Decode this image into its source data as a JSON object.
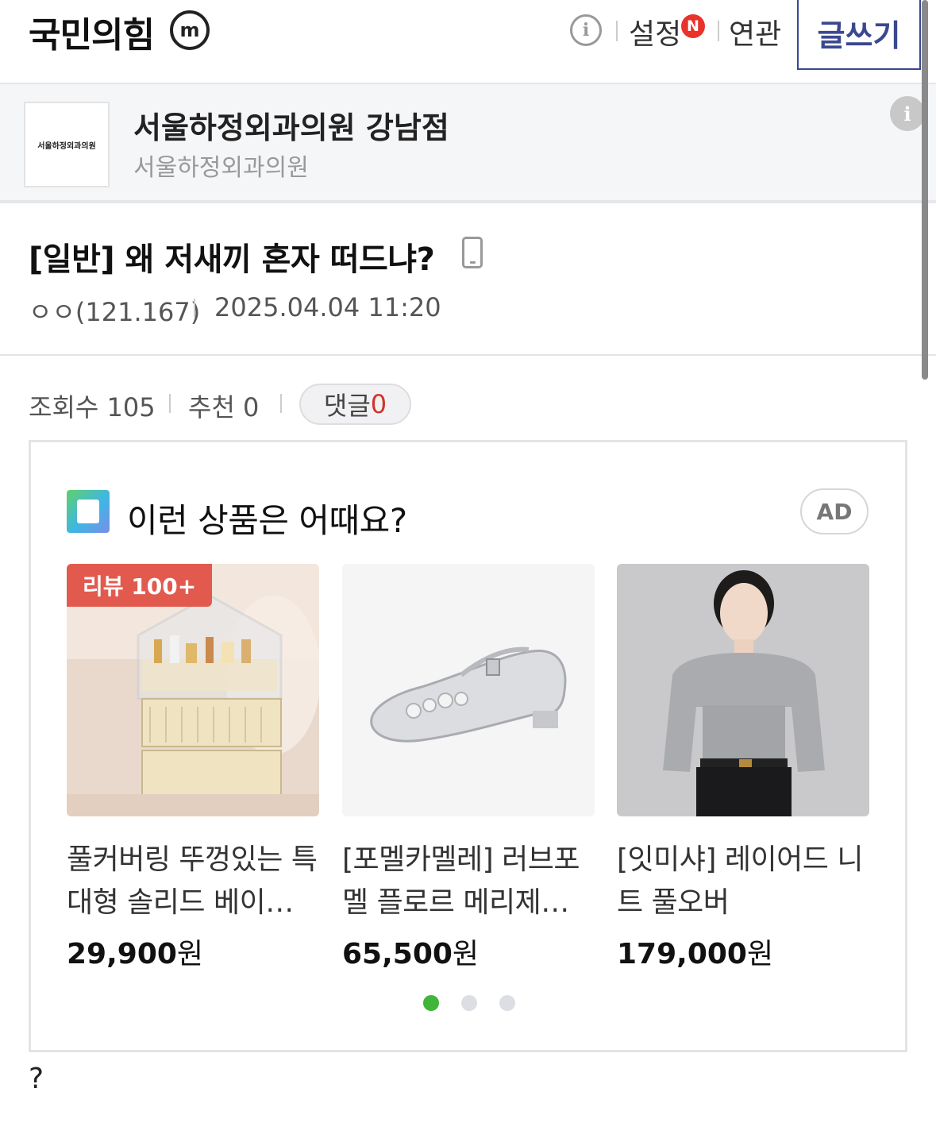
{
  "header": {
    "gallery_title": "국민의힘",
    "mi_icon_label": "m",
    "info_icon_label": "i",
    "settings_label": "설정",
    "new_badge": "N",
    "related_label": "연관",
    "write_button": "글쓰기"
  },
  "banner": {
    "logo_text": "서울하정외과의원",
    "title": "서울하정외과의원 강남점",
    "subtitle": "서울하정외과의원",
    "info_icon_label": "i"
  },
  "post": {
    "title": "[일반] 왜 저새끼 혼자 떠드냐?",
    "author": "ㅇㅇ(121.167)",
    "date": "2025.04.04 11:20",
    "views_label": "조회수 105",
    "recommend_label": "추천 0",
    "comments_label": "댓글",
    "comments_count": "0",
    "body": "?"
  },
  "ad": {
    "heading": "이런 상품은 어때요?",
    "badge": "AD",
    "products": [
      {
        "tag": "리뷰 100+",
        "name": "풀커버링 뚜껑있는 특대형 솔리드 베이스 화장품 정리함",
        "price": "29,900",
        "unit": "원"
      },
      {
        "tag": "",
        "name": "[포멜카멜레] 러브포멜 플로르 메리제인 플랫슈즈",
        "price": "65,500",
        "unit": "원"
      },
      {
        "tag": "",
        "name": "[잇미샤] 레이어드 니트 풀오버",
        "price": "179,000",
        "unit": "원"
      }
    ],
    "carousel_pages": 3,
    "carousel_active": 1
  },
  "colors": {
    "accent_navy": "#3b4890",
    "badge_red": "#e8322b",
    "review_tag": "#e25a4e",
    "dot_active": "#3fb53a"
  }
}
